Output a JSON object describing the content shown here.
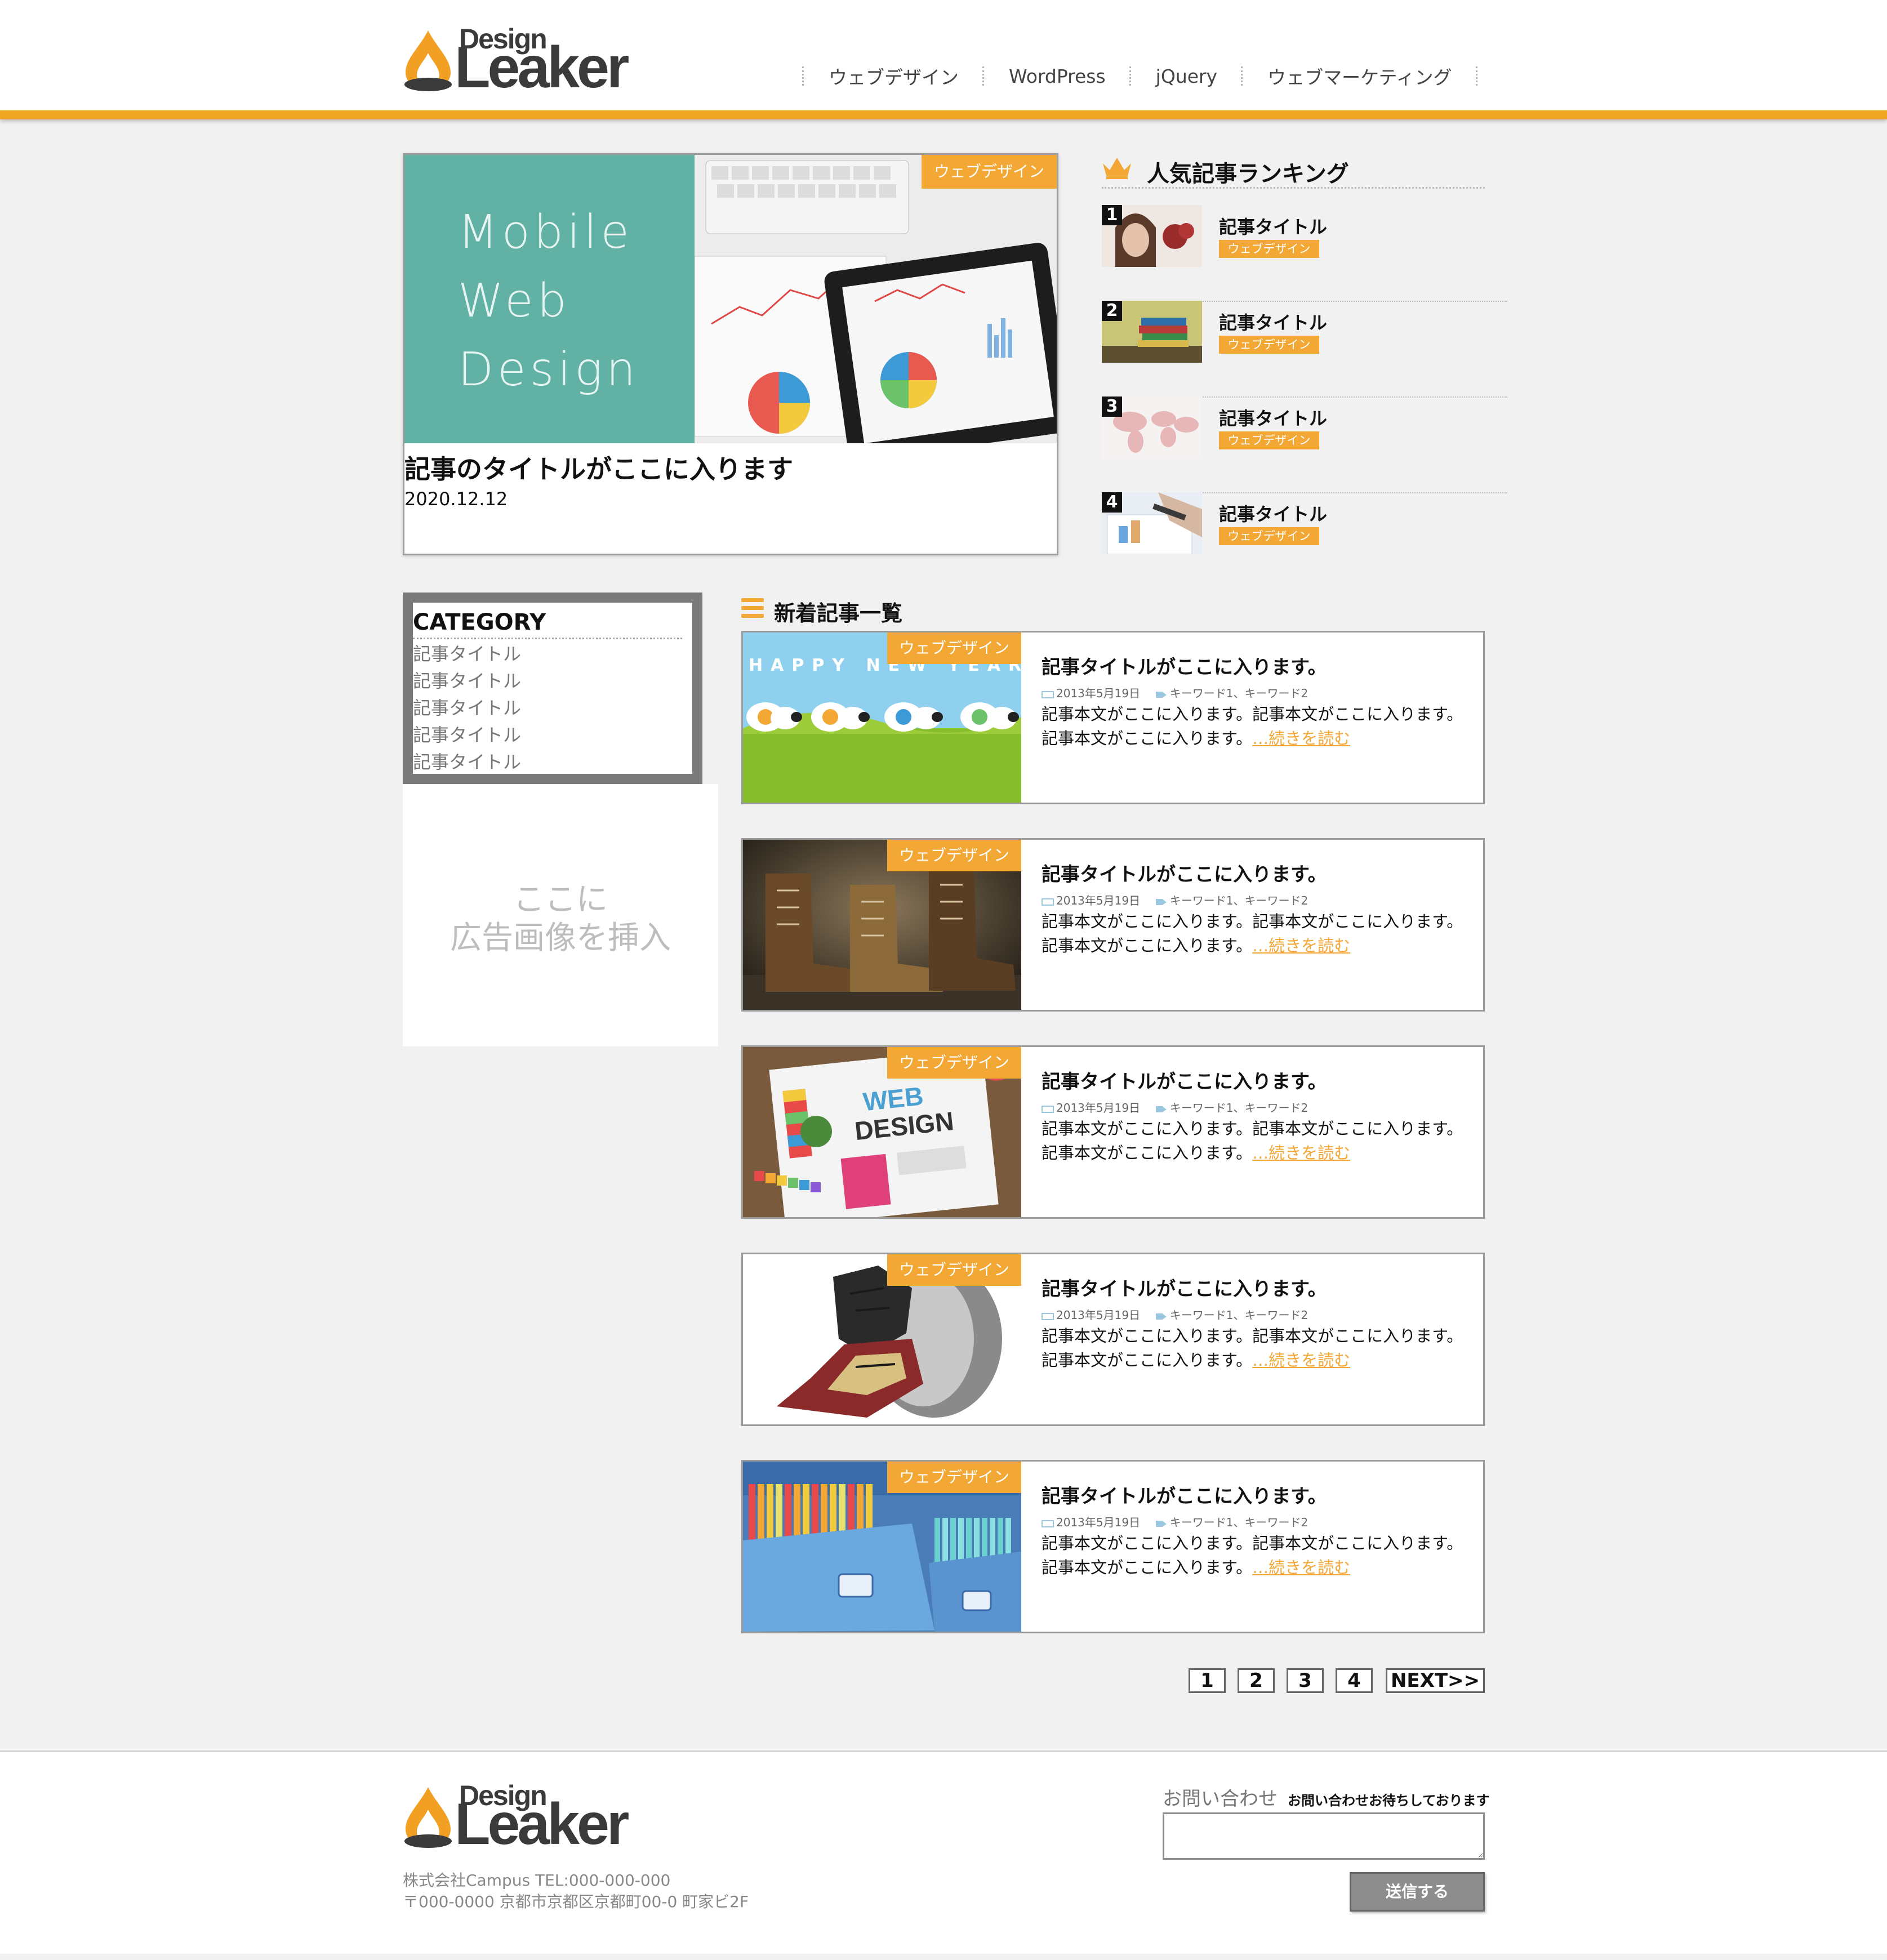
{
  "brand": {
    "logo_top": "Design",
    "logo_main": "Leaker",
    "accent": "#f0a623",
    "tag_color": "#f3a735"
  },
  "nav": {
    "items": [
      "ウェブデザイン",
      "WordPress",
      "jQuery",
      "ウェブマーケティング"
    ]
  },
  "featured": {
    "image_words": [
      "Mobile",
      "Web",
      "Design"
    ],
    "tag": "ウェブデザイン",
    "title": "記事のタイトルがここに入ります",
    "date": "2020.12.12"
  },
  "ranking": {
    "title": "人気記事ランキング",
    "items": [
      {
        "num": "1",
        "title": "記事タイトル",
        "tag": "ウェブデザイン"
      },
      {
        "num": "2",
        "title": "記事タイトル",
        "tag": "ウェブデザイン"
      },
      {
        "num": "3",
        "title": "記事タイトル",
        "tag": "ウェブデザイン"
      },
      {
        "num": "4",
        "title": "記事タイトル",
        "tag": "ウェブデザイン"
      }
    ]
  },
  "category": {
    "title": "CATEGORY",
    "items": [
      "記事タイトル",
      "記事タイトル",
      "記事タイトル",
      "記事タイトル",
      "記事タイトル"
    ]
  },
  "ad": {
    "line1": "ここに",
    "line2": "広告画像を挿入"
  },
  "new_articles": {
    "title": "新着記事一覧",
    "items": [
      {
        "tag": "ウェブデザイン",
        "title": "記事タイトルがここに入ります。",
        "date": "2013年5月19日",
        "keywords": "キーワード1、キーワード2",
        "body": "記事本文がここに入ります。記事本文がここに入ります。記事本文がここに入ります。",
        "more": "…続きを読む",
        "image_text": "HAPPY NEW YEAR"
      },
      {
        "tag": "ウェブデザイン",
        "title": "記事タイトルがここに入ります。",
        "date": "2013年5月19日",
        "keywords": "キーワード1、キーワード2",
        "body": "記事本文がここに入ります。記事本文がここに入ります。記事本文がここに入ります。",
        "more": "…続きを読む"
      },
      {
        "tag": "ウェブデザイン",
        "title": "記事タイトルがここに入ります。",
        "date": "2013年5月19日",
        "keywords": "キーワード1、キーワード2",
        "body": "記事本文がここに入ります。記事本文がここに入ります。記事本文がここに入ります。",
        "more": "…続きを読む",
        "image_text_1": "WEB",
        "image_text_2": "DESIGN"
      },
      {
        "tag": "ウェブデザイン",
        "title": "記事タイトルがここに入ります。",
        "date": "2013年5月19日",
        "keywords": "キーワード1、キーワード2",
        "body": "記事本文がここに入ります。記事本文がここに入ります。記事本文がここに入ります。",
        "more": "…続きを読む"
      },
      {
        "tag": "ウェブデザイン",
        "title": "記事タイトルがここに入ります。",
        "date": "2013年5月19日",
        "keywords": "キーワード1、キーワード2",
        "body": "記事本文がここに入ります。記事本文がここに入ります。記事本文がここに入ります。",
        "more": "…続きを読む"
      }
    ]
  },
  "pagination": {
    "pages": [
      "1",
      "2",
      "3",
      "4"
    ],
    "next": "NEXT>>"
  },
  "footer": {
    "company": "株式会社Campus TEL:000-000-000",
    "address": "〒000-0000 京都市京都区京都町00-0 町家ビ2F",
    "contact_title": "お問い合わせ",
    "contact_sub": "お問い合わせお待ちしております",
    "submit": "送信する"
  }
}
